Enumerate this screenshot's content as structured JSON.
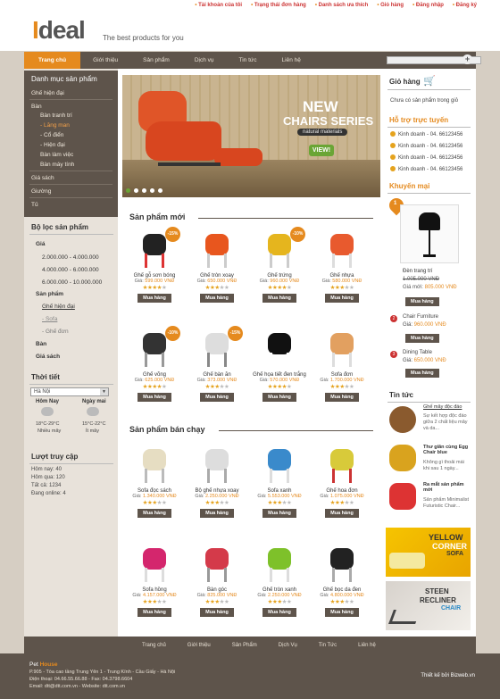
{
  "toplinks": [
    "Tài khoản của tôi",
    "Trạng thái đơn hàng",
    "Danh sách ưa thích",
    "Giỏ hàng",
    "Đăng nhập",
    "Đăng ký"
  ],
  "logo": {
    "i": "I",
    "rest": "deal",
    "tagline": "The best products for you"
  },
  "nav": [
    "Trang chủ",
    "Giới thiệu",
    "Sản phẩm",
    "Dịch vụ",
    "Tin tức",
    "Liên hệ"
  ],
  "search": {
    "placeholder": "",
    "button": "+"
  },
  "categories": {
    "title": "Danh mục sản phẩm",
    "items": [
      "Ghế hiện đại",
      "Bàn",
      "Bàn tranh trí",
      "- Lăng man",
      "- Cổ điển",
      "- Hiện đại",
      "Bàn làm việc",
      "Bàn máy tính",
      "Giá sách",
      "Giường",
      "Tủ"
    ]
  },
  "filter": {
    "title": "Bộ lọc sản phẩm",
    "gia": "Giá",
    "ranges": [
      "2.000.000 - 4.000.000",
      "4.000.000 - 6.000.000",
      "6.000.000 - 10.000.000"
    ],
    "sanpham": "Sản phẩm",
    "sub": [
      "Ghế hiện đại",
      "- Sofa",
      "- Ghế đơn"
    ],
    "ban": "Bàn",
    "giasach": "Giá sách"
  },
  "weather": {
    "title": "Thời tiết",
    "city": "Hà Nội",
    "today": "Hôm Nay",
    "tomorrow": "Ngày mai",
    "t1": "18°C-29°C",
    "d1": "Nhiều mây",
    "t2": "15°C-22°C",
    "d2": "Ít mây"
  },
  "visits": {
    "title": "Lượt truy cập",
    "rows": [
      "Hôm nay: 40",
      "Hôm qua: 120",
      "Tất cả: 1234",
      "Đang online: 4"
    ]
  },
  "slider": {
    "new": "NEW",
    "series": "CHAIRS SERIES",
    "natural": "natural materials",
    "view": "VIEW!"
  },
  "new_products_title": "Sản phẩm mới",
  "best_title": "Sản phẩm bán chạy",
  "price_label": "Giá:",
  "buy": "Mua hàng",
  "products_new": [
    {
      "name": "Ghế gỗ sơn bóng",
      "price": "599.000 VNĐ",
      "badge": "-15%",
      "stars": 4
    },
    {
      "name": "Ghế tròn xoay",
      "price": "650.000 VNĐ",
      "badge": "",
      "stars": 3
    },
    {
      "name": "Ghế trứng",
      "price": "960.000 VNĐ",
      "badge": "-10%",
      "stars": 4
    },
    {
      "name": "Ghế nhựa",
      "price": "580.000 VNĐ",
      "badge": "",
      "stars": 3
    },
    {
      "name": "Ghế võng",
      "price": "625.000 VNĐ",
      "badge": "-10%",
      "stars": 4
    },
    {
      "name": "Ghế bàn ăn",
      "price": "373.000 VNĐ",
      "badge": "-15%",
      "stars": 3
    },
    {
      "name": "Ghế họa tiết đen trắng",
      "price": "570.000 VNĐ",
      "badge": "",
      "stars": 4
    },
    {
      "name": "Sofa đơn",
      "price": "1.700.000 VNĐ",
      "badge": "",
      "stars": 3
    }
  ],
  "products_best": [
    {
      "name": "Sofa đọc sách",
      "price": "1.340.000 VNĐ",
      "stars": 3
    },
    {
      "name": "Bộ ghế nhựa xoay",
      "price": "2.250.000 VNĐ",
      "stars": 3
    },
    {
      "name": "Sofa xanh",
      "price": "5.553.000 VNĐ",
      "stars": 3
    },
    {
      "name": "Ghế hoa đơn",
      "price": "1.075.000 VNĐ",
      "stars": 3
    },
    {
      "name": "Sofa hồng",
      "price": "4.157.000 VNĐ",
      "stars": 3
    },
    {
      "name": "Bàn góc",
      "price": "825.000 VNĐ",
      "stars": 3
    },
    {
      "name": "Ghế tròn xanh",
      "price": "2.250.000 VNĐ",
      "stars": 3
    },
    {
      "name": "Ghế bọc da đen",
      "price": "4.800.000 VNĐ",
      "stars": 3
    }
  ],
  "cart": {
    "title": "Giỏ hàng",
    "empty": "Chưa có sản phẩm trong giỏ"
  },
  "support": {
    "title": "Hỗ trợ trực tuyến",
    "rows": [
      "Kinh doanh - 04. 66123456",
      "Kinh doanh - 04. 66123456",
      "Kinh doanh - 04. 66123456",
      "Kinh doanh - 04. 66123456"
    ]
  },
  "promo": {
    "title": "Khuyến mại",
    "num": "1",
    "main_name": "Đèn trang trí",
    "main_old": "1.005.000 VNĐ",
    "main_new": "805.000 VNĐ",
    "p2": "Chair Furniture",
    "p2_num": "2",
    "p2_price": "960.000 VNĐ",
    "p3": "Dining Table",
    "p3_num": "3",
    "p3_price": "650.000 VNĐ"
  },
  "news": {
    "title": "Tin tức",
    "items": [
      {
        "title": "Ghế mây độc đáo",
        "desc": "Sự kết hợp độc đáo giữa 2 chất liệu mây và da..."
      },
      {
        "title": "Thư giãn cùng Egg Chair blue",
        "desc": "Không gì thoải mái khi sau 1 ngày..."
      },
      {
        "title": "Ra mắt sản phẩm mới",
        "desc": "Sản phẩm Minimalist Futuristic Chair..."
      }
    ]
  },
  "banners": {
    "b1a": "YELLOW",
    "b1b": "CORNER",
    "b1c": "SOFA",
    "b2a": "STEEN",
    "b2b": "RECLINER",
    "b2c": "CHAIR"
  },
  "footnav": [
    "Trang chủ",
    "Giới thiệu",
    "Sản Phẩm",
    "Dịch Vụ",
    "Tin Tức",
    "Liên hệ"
  ],
  "footer": {
    "name_a": "Pet",
    "name_b": "House",
    "addr": "P.905 - Tòa cao tầng Trung Yên 1 - Trung Kính - Cầu Giấy - Hà Nội",
    "phone": "Điện thoại: 04.66.55.66.88 - Fax: 04.3798.6604",
    "email": "Email: dtt@dtt.com.vn - Website: dtt.com.vn",
    "designed": "Thiết kế bởi Bizweb.vn"
  },
  "colors": {
    "accent": "#e58a1e",
    "dark": "#5e544b",
    "link": "#cc3333"
  }
}
